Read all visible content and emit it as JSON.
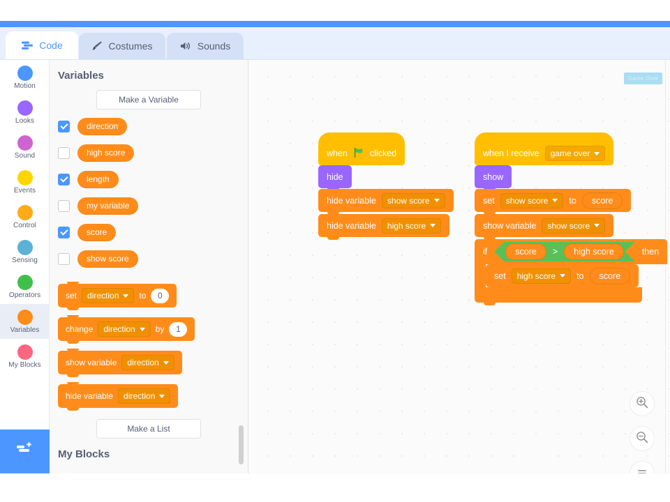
{
  "tabs": [
    {
      "id": "code",
      "label": "Code",
      "icon": "code-icon",
      "active": true
    },
    {
      "id": "costumes",
      "label": "Costumes",
      "icon": "paintbrush-icon",
      "active": false
    },
    {
      "id": "sounds",
      "label": "Sounds",
      "icon": "speaker-icon",
      "active": false
    }
  ],
  "categories": [
    {
      "label": "Motion",
      "color": "#4c97ff",
      "selected": false
    },
    {
      "label": "Looks",
      "color": "#9966ff",
      "selected": false
    },
    {
      "label": "Sound",
      "color": "#cf63cf",
      "selected": false
    },
    {
      "label": "Events",
      "color": "#ffd500",
      "selected": false
    },
    {
      "label": "Control",
      "color": "#ffab19",
      "selected": false
    },
    {
      "label": "Sensing",
      "color": "#5cb1d6",
      "selected": false
    },
    {
      "label": "Operators",
      "color": "#40bf4a",
      "selected": false
    },
    {
      "label": "Variables",
      "color": "#ff8c1a",
      "selected": true
    },
    {
      "label": "My Blocks",
      "color": "#ff6680",
      "selected": false
    }
  ],
  "add_extension": {
    "icon": "add-extension-icon",
    "color": "#4c97ff"
  },
  "palette": {
    "heading": "Variables",
    "make_variable_label": "Make a Variable",
    "make_list_label": "Make a List",
    "next_heading": "My Blocks",
    "variables": [
      {
        "name": "direction",
        "checked": true
      },
      {
        "name": "high score",
        "checked": false
      },
      {
        "name": "length",
        "checked": true
      },
      {
        "name": "my variable",
        "checked": false
      },
      {
        "name": "score",
        "checked": true
      },
      {
        "name": "show score",
        "checked": false
      }
    ],
    "blocks": [
      {
        "type": "set",
        "words": [
          "set",
          "to"
        ],
        "dropdown": "direction",
        "value": "0"
      },
      {
        "type": "change",
        "words": [
          "change",
          "by"
        ],
        "dropdown": "direction",
        "value": "1"
      },
      {
        "type": "show-variable",
        "words": [
          "show variable"
        ],
        "dropdown": "direction"
      },
      {
        "type": "hide-variable",
        "words": [
          "hide variable"
        ],
        "dropdown": "direction"
      }
    ]
  },
  "workspace": {
    "monitor_label": "Game Over",
    "script_left": {
      "hat": {
        "pre": "when",
        "post": "clicked",
        "icon": "green-flag-icon"
      },
      "blocks": [
        {
          "kind": "looks",
          "label": "hide"
        },
        {
          "kind": "vars",
          "label": "hide variable",
          "dropdown": "show score"
        },
        {
          "kind": "vars",
          "label": "hide variable",
          "dropdown": "high score"
        }
      ]
    },
    "script_right": {
      "hat": {
        "label": "when I receive",
        "dropdown": "game over"
      },
      "blocks": [
        {
          "kind": "looks",
          "label": "show"
        },
        {
          "kind": "vars",
          "label": "set",
          "dropdown": "show score",
          "mid": "to",
          "reporter": "score"
        },
        {
          "kind": "vars",
          "label": "show variable",
          "dropdown": "show score"
        }
      ],
      "if_block": {
        "if_label": "if",
        "then_label": "then",
        "condition": {
          "left": "score",
          "operator": ">",
          "right": "high score"
        },
        "inner": {
          "label": "set",
          "dropdown": "high score",
          "mid": "to",
          "reporter": "score"
        }
      }
    },
    "zoom_controls": [
      {
        "id": "zoom-in",
        "icon": "zoom-in-icon"
      },
      {
        "id": "zoom-out",
        "icon": "zoom-out-icon"
      },
      {
        "id": "zoom-reset",
        "icon": "zoom-reset-icon"
      }
    ]
  }
}
